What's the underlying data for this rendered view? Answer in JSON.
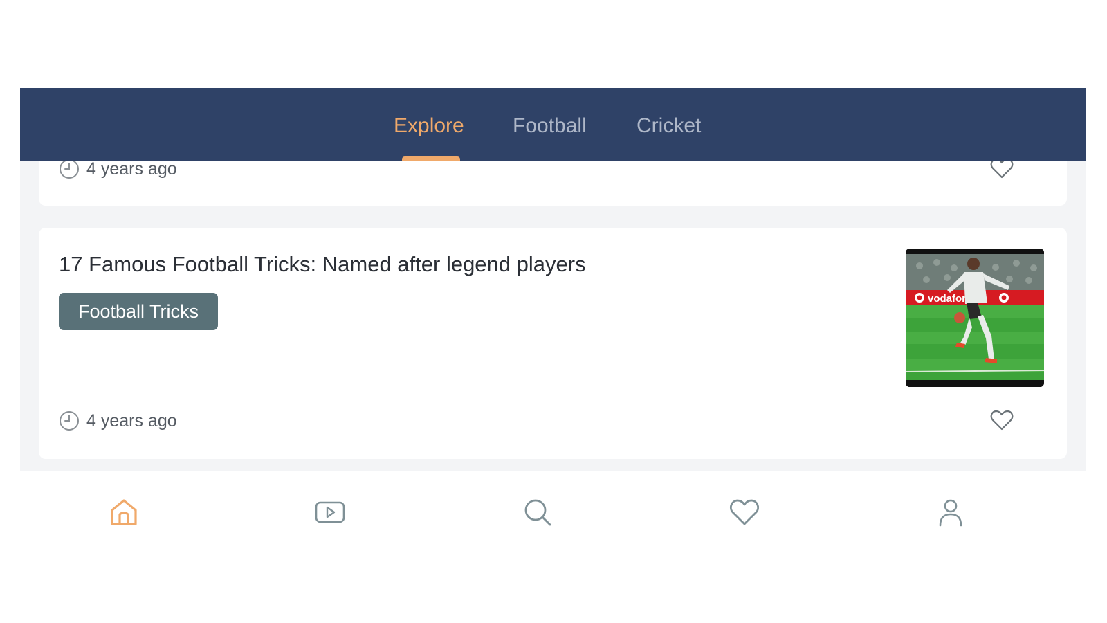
{
  "tabs": [
    {
      "label": "Explore",
      "active": true
    },
    {
      "label": "Football",
      "active": false
    },
    {
      "label": "Cricket",
      "active": false
    }
  ],
  "articles": [
    {
      "time": "4 years ago"
    },
    {
      "title": "17 Famous Football Tricks: Named after legend players",
      "tag": "Football Tricks",
      "time": "4 years ago",
      "thumbnail_ad_text": "vodafone"
    }
  ],
  "bottom_nav": [
    {
      "icon": "home-icon",
      "active": true
    },
    {
      "icon": "video-icon",
      "active": false
    },
    {
      "icon": "search-icon",
      "active": false
    },
    {
      "icon": "heart-icon",
      "active": false
    },
    {
      "icon": "profile-icon",
      "active": false
    }
  ],
  "colors": {
    "header_bg": "#2f4267",
    "accent": "#f0a96a",
    "tag_bg": "#597178",
    "inactive_tab": "#aeb7c8",
    "icon_gray": "#7f9096"
  }
}
